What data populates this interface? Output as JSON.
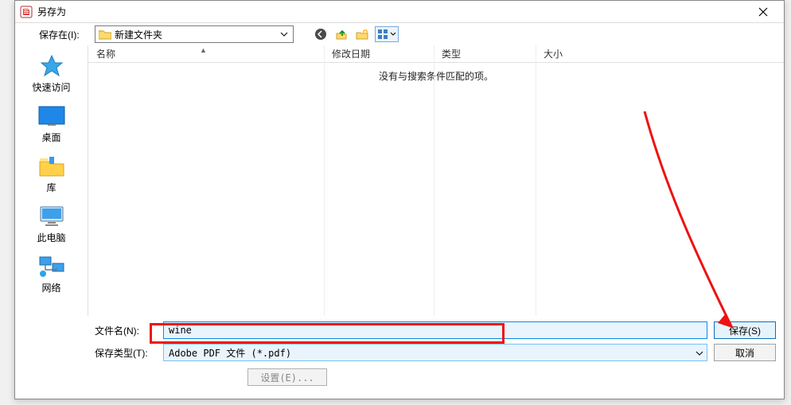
{
  "title": "另存为",
  "toolbar": {
    "savein_label": "保存在(I):",
    "location_text": "新建文件夹"
  },
  "columns": {
    "name": "名称",
    "date": "修改日期",
    "type": "类型",
    "size": "大小"
  },
  "empty_message": "没有与搜索条件匹配的项。",
  "places": {
    "quick": "快速访问",
    "desktop": "桌面",
    "libraries": "库",
    "thispc": "此电脑",
    "network": "网络"
  },
  "fields": {
    "filename_label": "文件名(N):",
    "filename_value": "wine",
    "filetype_label": "保存类型(T):",
    "filetype_value": "Adobe PDF 文件 (*.pdf)"
  },
  "buttons": {
    "save": "保存(S)",
    "cancel": "取消",
    "settings": "设置(E)..."
  }
}
